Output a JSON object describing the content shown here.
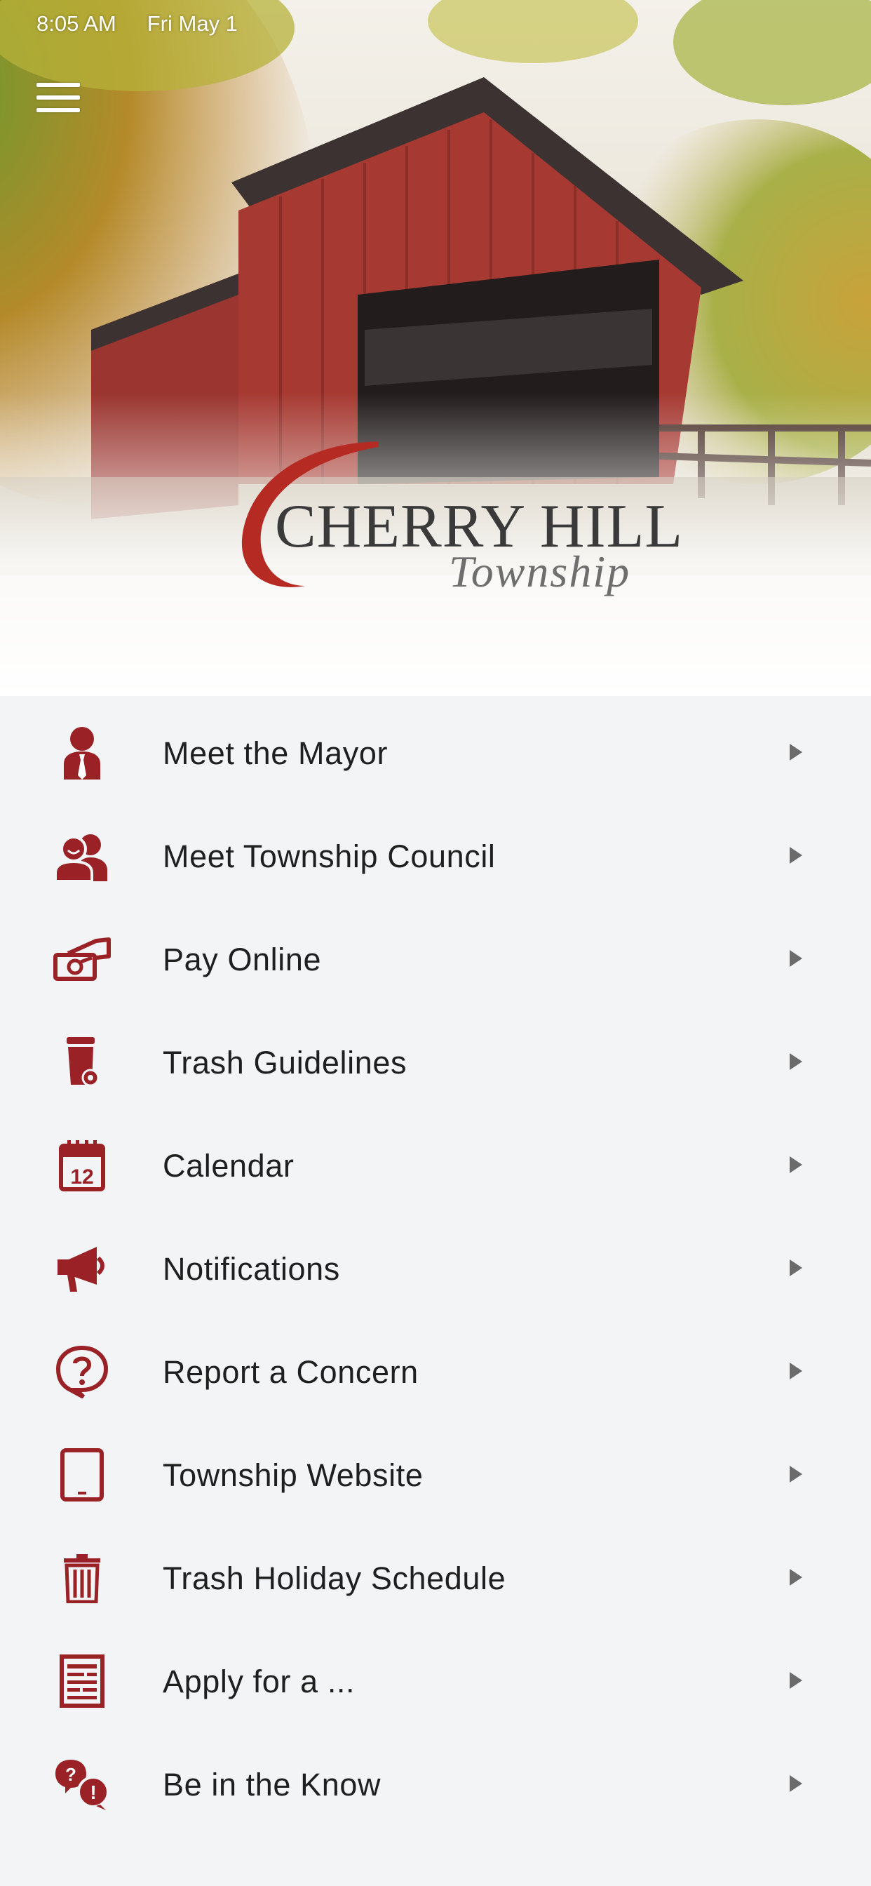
{
  "status_bar": {
    "time": "8:05 AM",
    "date": "Fri May 1"
  },
  "header": {
    "menu_icon": "hamburger-icon",
    "logo": {
      "main": "CHERRY HILL",
      "sub": "Township"
    }
  },
  "colors": {
    "brand": "#9a2226",
    "background": "#f3f4f6",
    "text": "#1f1f1f",
    "chevron": "#6b6b6b"
  },
  "menu": {
    "items": [
      {
        "label": "Meet the Mayor",
        "icon": "mayor-icon"
      },
      {
        "label": "Meet Township Council",
        "icon": "council-icon"
      },
      {
        "label": "Pay Online",
        "icon": "payment-icon"
      },
      {
        "label": "Trash Guidelines",
        "icon": "trash-bin-icon"
      },
      {
        "label": "Calendar",
        "icon": "calendar-icon"
      },
      {
        "label": "Notifications",
        "icon": "megaphone-icon"
      },
      {
        "label": "Report a Concern",
        "icon": "question-bubble-icon"
      },
      {
        "label": "Township Website",
        "icon": "tablet-icon"
      },
      {
        "label": "Trash Holiday Schedule",
        "icon": "trash-can-icon"
      },
      {
        "label": "Apply for a ...",
        "icon": "form-icon"
      },
      {
        "label": "Be in the Know",
        "icon": "chat-info-icon"
      }
    ]
  }
}
